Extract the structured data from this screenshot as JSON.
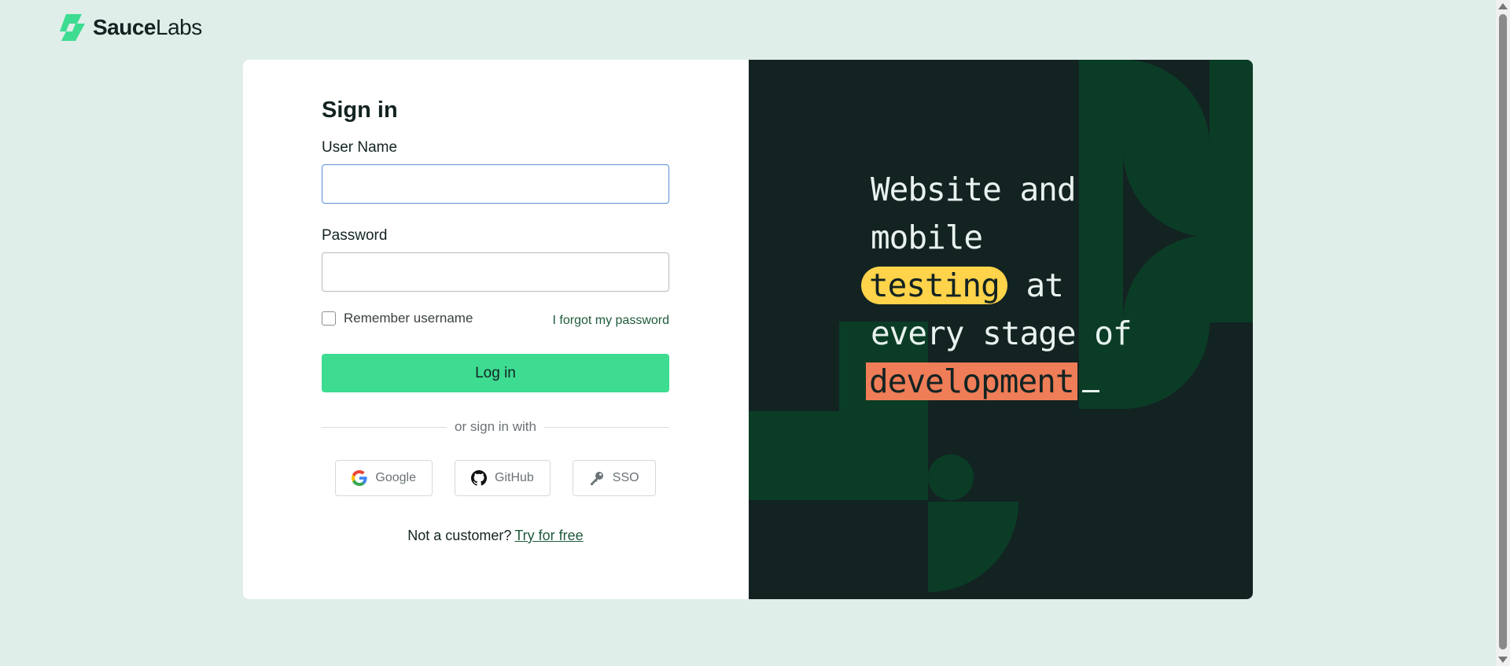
{
  "brand": {
    "name_bold": "Sauce",
    "name_light": "Labs",
    "color": "#3ddc91"
  },
  "form": {
    "title": "Sign in",
    "username_label": "User Name",
    "username_value": "",
    "password_label": "Password",
    "password_value": "",
    "remember_label": "Remember username",
    "remember_checked": false,
    "forgot_link": "I forgot my password",
    "login_button": "Log in",
    "divider_text": "or sign in with",
    "providers": [
      {
        "label": "Google",
        "icon": "google-icon"
      },
      {
        "label": "GitHub",
        "icon": "github-icon"
      },
      {
        "label": "SSO",
        "icon": "key-icon"
      }
    ],
    "footer_text": "Not a customer?",
    "footer_link": "Try for free"
  },
  "promo": {
    "line1": "Website and",
    "line2": "mobile",
    "word_testing": "testing",
    "word_at": "at",
    "line4": "every stage of",
    "word_development": "development",
    "colors": {
      "background": "#132322",
      "shapes": "#0b3d26",
      "highlight_yellow": "#ffd34a",
      "highlight_orange": "#ef7d57"
    }
  }
}
